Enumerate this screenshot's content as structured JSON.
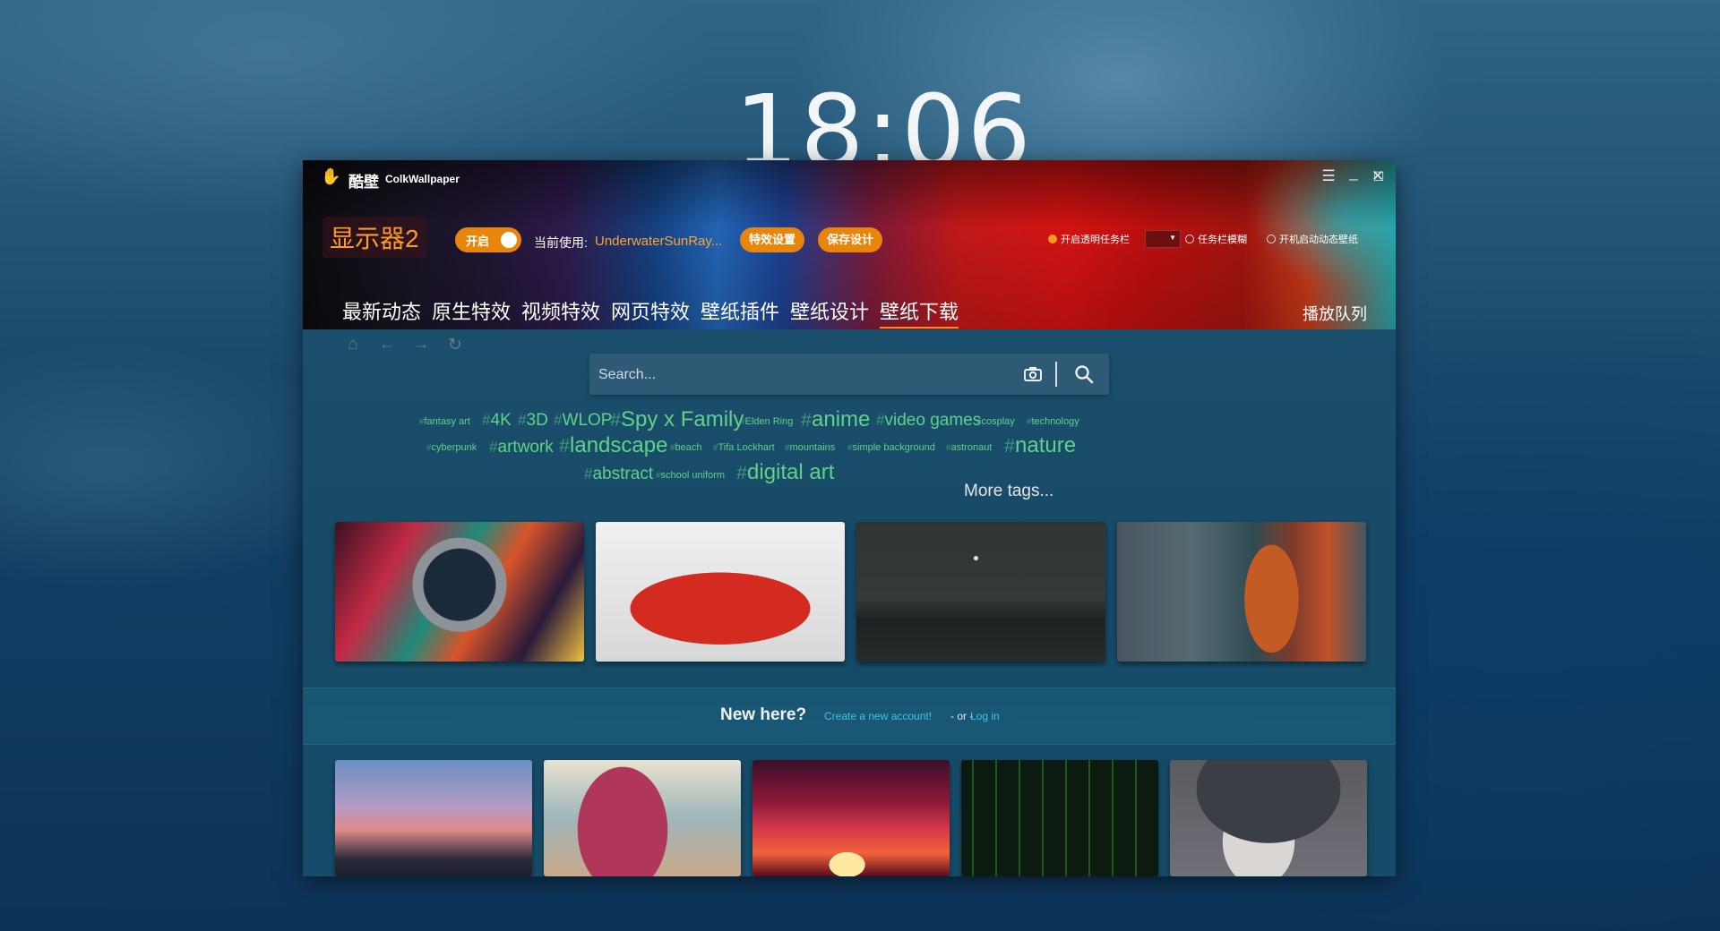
{
  "desktop": {
    "clock": "18:06"
  },
  "app": {
    "title_cn": "酷壁",
    "title_en": "ColkWallpaper",
    "controls": [
      "☰",
      "_",
      "☐",
      "✕"
    ]
  },
  "toolbar": {
    "monitor": "显示器2",
    "toggle_label": "开启",
    "current_label": "当前使用:",
    "current_value": "UnderwaterSunRay...",
    "effect_button": "特效设置",
    "save_button": "保存设计",
    "option1": "开启透明任务栏",
    "option2": "任务栏模糊",
    "option3": "开机启动动态壁纸"
  },
  "tabs": [
    "最新动态",
    "原生特效",
    "视频特效",
    "网页特效",
    "壁纸插件",
    "壁纸设计",
    "壁纸下载"
  ],
  "play_queue": "播放队列",
  "search": {
    "placeholder": "Search..."
  },
  "tags": [
    "fantasy art",
    "4K",
    "3D",
    "WLOP",
    "Spy x Family",
    "Elden Ring",
    "anime",
    "video games",
    "cosplay",
    "technology",
    "cyberpunk",
    "artwork",
    "landscape",
    "beach",
    "Tifa Lockhart",
    "mountains",
    "simple background",
    "astronaut",
    "nature",
    "abstract",
    "school uniform",
    "digital art"
  ],
  "more_tags": "More tags...",
  "new_here": {
    "title": "New here?",
    "create": "Create a new account!",
    "or": "- or -",
    "login": "Log in"
  },
  "colors": {
    "accent": "#e8860c",
    "tag_green": "#5fd28a",
    "link_blue": "#3fc6e4"
  },
  "icons": [
    "home-icon",
    "back-arrow-icon",
    "forward-arrow-icon",
    "refresh-icon",
    "camera-icon",
    "search-icon"
  ]
}
